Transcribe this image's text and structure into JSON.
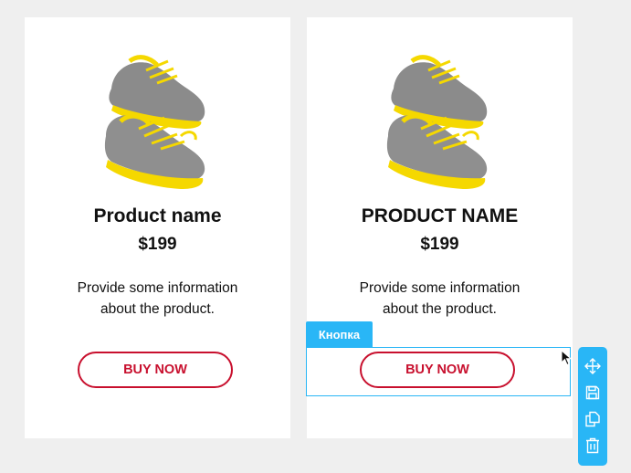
{
  "cards": [
    {
      "title": "Product name",
      "price": "$199",
      "description_line1": "Provide some information",
      "description_line2": "about the product.",
      "button_label": "BUY NOW",
      "image": "sneakers-image"
    },
    {
      "title": "PRODUCT NAME",
      "price": "$199",
      "description_line1": "Provide some information",
      "description_line2": "about the product.",
      "button_label": "BUY NOW",
      "image": "sneakers-image"
    }
  ],
  "selection": {
    "tag_label": "Кнопка",
    "toolbar_icons": [
      "move-icon",
      "save-icon",
      "duplicate-icon",
      "delete-icon"
    ]
  },
  "colors": {
    "accent": "#c8102e",
    "selection": "#29b6f6",
    "background": "#efefef",
    "card": "#ffffff"
  }
}
